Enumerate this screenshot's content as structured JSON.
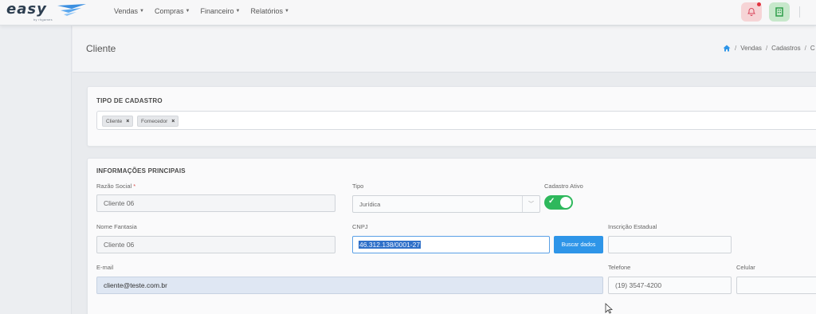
{
  "brand": {
    "logo_text": "easy",
    "logo_sub": "by rhgames"
  },
  "nav": {
    "items": [
      {
        "label": "Vendas"
      },
      {
        "label": "Compras"
      },
      {
        "label": "Financeiro"
      },
      {
        "label": "Relatórios"
      }
    ]
  },
  "page": {
    "title": "Cliente"
  },
  "breadcrumb": {
    "items": [
      "Vendas",
      "Cadastros",
      "C"
    ]
  },
  "tipo_cadastro": {
    "title": "TIPO DE CADASTRO",
    "tags": [
      {
        "label": "Cliente"
      },
      {
        "label": "Fornecedor"
      }
    ]
  },
  "info": {
    "title": "INFORMAÇÕES PRINCIPAIS",
    "razao_social": {
      "label": "Razão Social",
      "required_mark": "*",
      "value": "Cliente 06"
    },
    "tipo": {
      "label": "Tipo",
      "value": "Jurídica"
    },
    "cadastro_ativo": {
      "label": "Cadastro Ativo",
      "on": true
    },
    "nome_fantasia": {
      "label": "Nome Fantasia",
      "value": "Cliente 06"
    },
    "cnpj": {
      "label": "CNPJ",
      "value": "46.312.138/0001-27"
    },
    "buscar_label": "Buscar dados",
    "inscricao_estadual": {
      "label": "Inscrição Estadual",
      "value": ""
    },
    "email": {
      "label": "E-mail",
      "value": "cliente@teste.com.br"
    },
    "telefone": {
      "label": "Telefone",
      "value": "(19) 3547-4200"
    },
    "celular": {
      "label": "Celular",
      "value": ""
    }
  },
  "colors": {
    "accent_blue": "#2e95e8",
    "toggle_green": "#2eb85c",
    "selection": "#2f70c8"
  }
}
